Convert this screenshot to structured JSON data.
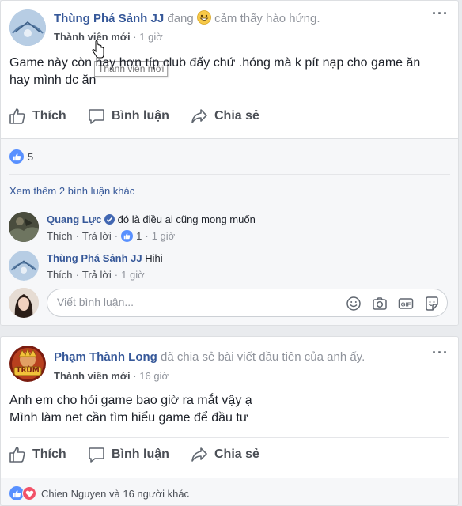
{
  "post1": {
    "author": "Thùng Phá Sảnh JJ",
    "activity_pre": "đang",
    "activity_post": "cảm thấy hào hứng.",
    "role": "Thành viên mới",
    "dot": "·",
    "time": "1 giờ",
    "tooltip": "Thành viên mới",
    "text_line1": "Game này còn hay hơn típ club đấy chứ .hóng mà k pít nạp cho game ăn",
    "text_line2": "hay mình dc ăn",
    "actions": {
      "like": "Thích",
      "comment": "Bình luận",
      "share": "Chia sẻ"
    },
    "reaction_count": "5",
    "view_more": "Xem thêm 2 bình luận khác",
    "comments": [
      {
        "author": "Quang Lực",
        "text": "đó là điều ai cũng mong muốn",
        "like": "Thích",
        "reply": "Trả lời",
        "likes": "1",
        "time": "1 giờ"
      },
      {
        "author": "Thùng Phá Sảnh JJ",
        "text": "Hihi",
        "like": "Thích",
        "reply": "Trả lời",
        "time": "1 giờ"
      }
    ],
    "comment_placeholder": "Viết bình luận..."
  },
  "post2": {
    "author": "Phạm Thành Long",
    "activity": "đã chia sẻ bài viết đầu tiên của anh ấy.",
    "role": "Thành viên mới",
    "dot": "·",
    "time": "16 giờ",
    "avatar_text": "TRÙM",
    "text_line1": "Anh em cho hỏi game bao giờ ra mắt vậy ạ",
    "text_line2": "Mình làm net cần tìm hiểu game để đầu tư",
    "actions": {
      "like": "Thích",
      "comment": "Bình luận",
      "share": "Chia sẻ"
    },
    "reactors": "Chien Nguyen và 16 người khác"
  },
  "colors": {
    "link": "#365899",
    "like_blue": "#5890ff",
    "love_red": "#f25268",
    "muted": "#90949c"
  },
  "icons": [
    "more-icon",
    "like-icon",
    "comment-icon",
    "share-icon",
    "grin-emoji-icon",
    "verified-badge-icon",
    "emoji-icon",
    "camera-icon",
    "gif-icon",
    "sticker-icon",
    "cursor-icon",
    "love-icon"
  ]
}
